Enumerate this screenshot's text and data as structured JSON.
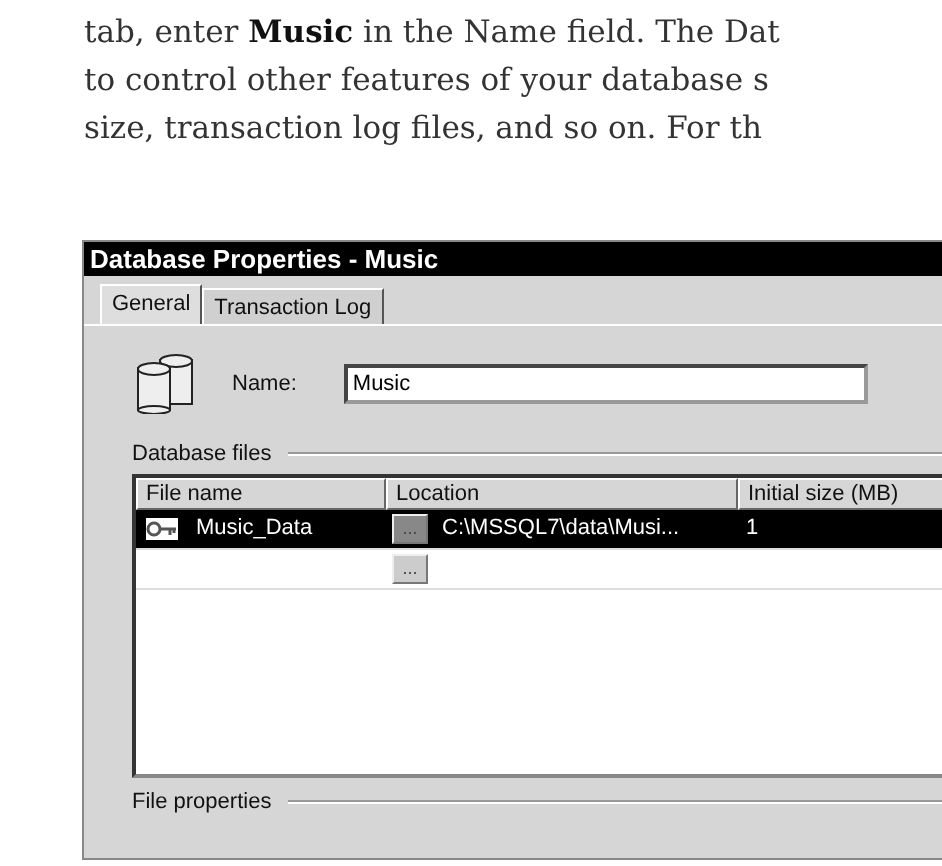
{
  "book_text": [
    "tab, enter **Music** in the Name field. The Dat",
    "to control other features of your database s",
    "size, transaction log files, and so on. For th"
  ],
  "window": {
    "title": "Database Properties - Music"
  },
  "tabs": [
    {
      "label": "General",
      "selected": true
    },
    {
      "label": "Transaction Log",
      "selected": false
    }
  ],
  "name_field": {
    "label": "Name:",
    "value": "Music"
  },
  "database_files": {
    "label": "Database files",
    "columns": [
      "File name",
      "Location",
      "Initial size (MB)"
    ],
    "rows": [
      {
        "selected": true,
        "file_name": "Music_Data",
        "browse": "...",
        "location": "C:\\MSSQL7\\data\\Musi...",
        "initial_size": "1"
      },
      {
        "selected": false,
        "browse": "..."
      }
    ]
  },
  "file_properties": {
    "label": "File properties"
  }
}
